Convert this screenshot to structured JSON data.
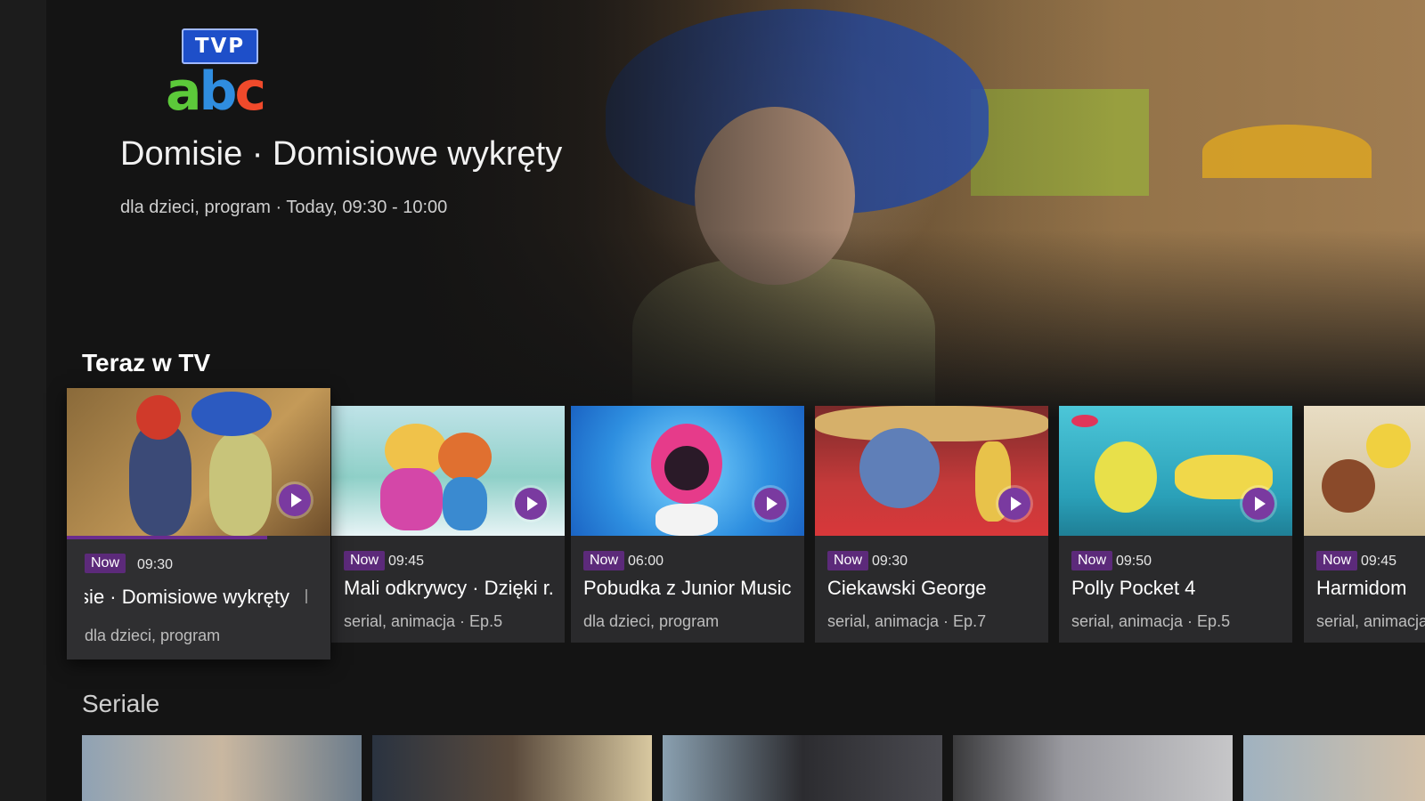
{
  "channel_logo": {
    "top": "TVP",
    "bottom": "abc"
  },
  "hero": {
    "title": "Domisie · Domisiowe wykręty",
    "meta": "dla dzieci, program · Today, 09:30 - 10:00"
  },
  "rows": {
    "now": {
      "title": "Teraz w TV"
    },
    "series": {
      "title": "Seriale"
    }
  },
  "now_cards": [
    {
      "badge": "Now",
      "time": "09:30",
      "title": "Domisie · Domisiowe wykręty",
      "meta": "dla dzieci, program",
      "progress": 0.76,
      "focused": true
    },
    {
      "badge": "Now",
      "time": "09:45",
      "title": "Mali odkrywcy · Dzięki r..",
      "meta": "serial, animacja · Ep.5"
    },
    {
      "badge": "Now",
      "time": "06:00",
      "title": "Pobudka z Junior Music",
      "meta": "dla dzieci, program"
    },
    {
      "badge": "Now",
      "time": "09:30",
      "title": "Ciekawski George",
      "meta": "serial, animacja · Ep.7"
    },
    {
      "badge": "Now",
      "time": "09:50",
      "title": "Polly Pocket 4",
      "meta": "serial, animacja · Ep.5"
    },
    {
      "badge": "Now",
      "time": "09:45",
      "title": "Harmidom",
      "meta": "serial, animacja"
    }
  ],
  "colors": {
    "background": "#141414",
    "card": "#2a2a2c",
    "badge": "#5c2a7a",
    "play": "#7a3aa0",
    "progress": "#6a2c8e"
  }
}
